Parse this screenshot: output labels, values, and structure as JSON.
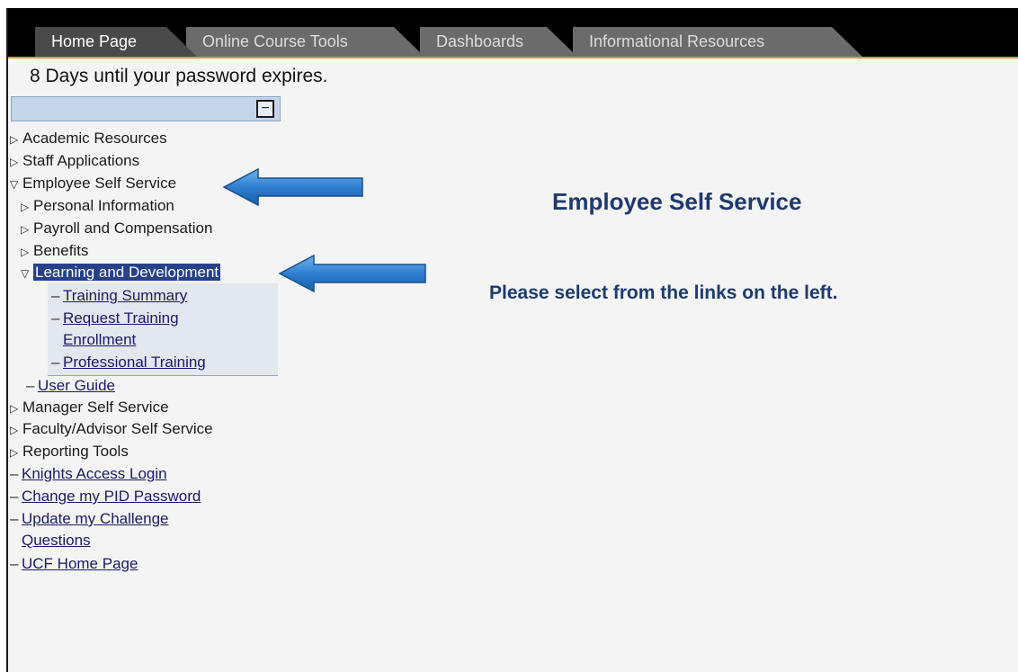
{
  "tabs": [
    "Home Page",
    "Online Course Tools",
    "Dashboards",
    "Informational Resources"
  ],
  "notice": "8 Days until your password expires.",
  "collapse_symbol": "−",
  "menu": {
    "academic": "Academic Resources",
    "staff": "Staff Applications",
    "ess": "Employee Self Service",
    "personal": "Personal Information",
    "payroll": "Payroll and Compensation",
    "benefits": "Benefits",
    "learning": "Learning and Development",
    "training_summary": "Training Summary",
    "request_training_1": "Request Training",
    "request_training_2": "Enrollment",
    "professional_training": "Professional Training",
    "user_guide": "User Guide",
    "manager": "Manager Self Service",
    "faculty": "Faculty/Advisor Self Service",
    "reporting": "Reporting Tools",
    "knights": "Knights Access Login",
    "change_pid": "Change my PID Password",
    "challenge_1": "Update my Challenge",
    "challenge_2": "Questions",
    "ucf_home": "UCF Home Page"
  },
  "main": {
    "title": "Employee Self Service",
    "instruction": "Please select from the links on the left."
  },
  "colors": {
    "tabbar": "#000000",
    "tab": "#6b6b6b",
    "selected": "#26418a",
    "heading": "#1e3a6e",
    "arrow": "#2f7fd0"
  },
  "icons": {
    "collapsed": "triangle-right-icon",
    "expanded": "triangle-down-icon",
    "leaf": "dash-icon",
    "annotation": "left-arrow-icon"
  }
}
